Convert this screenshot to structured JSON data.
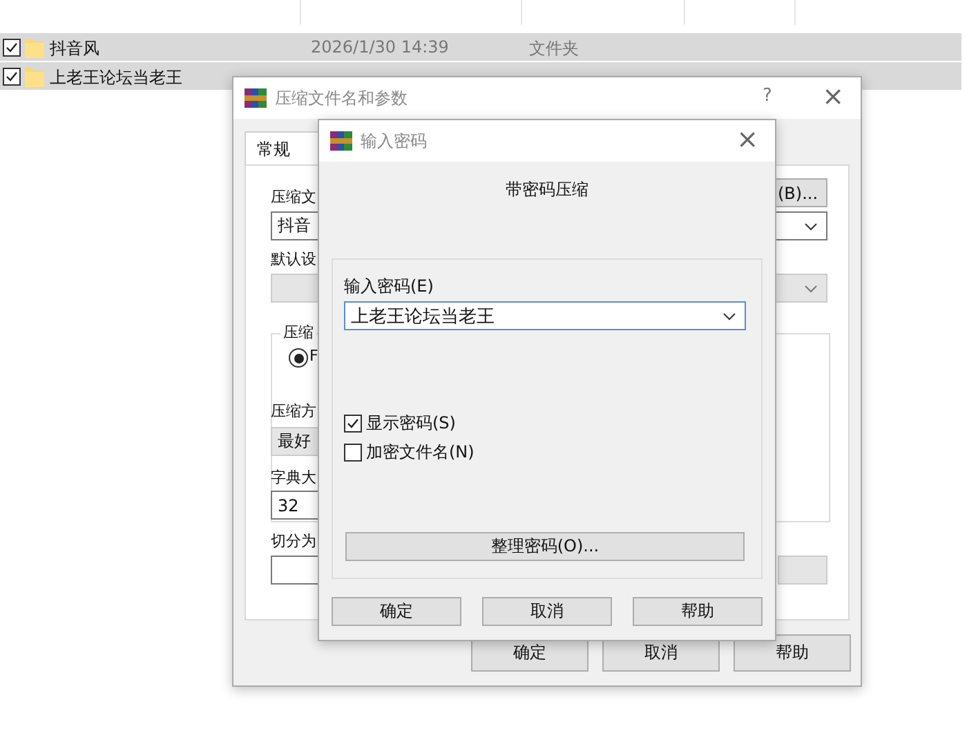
{
  "file_list": {
    "rows": [
      {
        "name": "抖音风",
        "date": "2026/1/30 14:39",
        "type": "文件夹",
        "checked": true,
        "selected": true
      },
      {
        "name": "上老王论坛当老王",
        "checked": true,
        "selected": true
      }
    ]
  },
  "archive_dialog": {
    "title": "压缩文件名和参数",
    "help": "?",
    "close": "×",
    "tabs": [
      {
        "label": "常规",
        "selected": true
      }
    ],
    "archive_name_label": "压缩文",
    "browse_button": "(B)...",
    "archive_name_value": "抖音",
    "profile_label": "默认设",
    "format_group_label": "压缩",
    "format_radio": {
      "label": "F",
      "selected": true
    },
    "method_label": "压缩方",
    "method_value": "最好",
    "dictionary_label": "字典大",
    "dictionary_value": "32",
    "split_label": "切分为",
    "buttons": [
      "确定",
      "取消",
      "帮助"
    ]
  },
  "password_dialog": {
    "title": "输入密码",
    "close": "×",
    "heading": "带密码压缩",
    "password_label": "输入密码(E)",
    "password_value": "上老王论坛当老王",
    "options": [
      {
        "label": "显示密码(S)",
        "checked": true
      },
      {
        "label": "加密文件名(N)",
        "checked": false
      }
    ],
    "organize_button": "整理密码(O)...",
    "buttons": [
      "确定",
      "取消",
      "帮助"
    ]
  }
}
